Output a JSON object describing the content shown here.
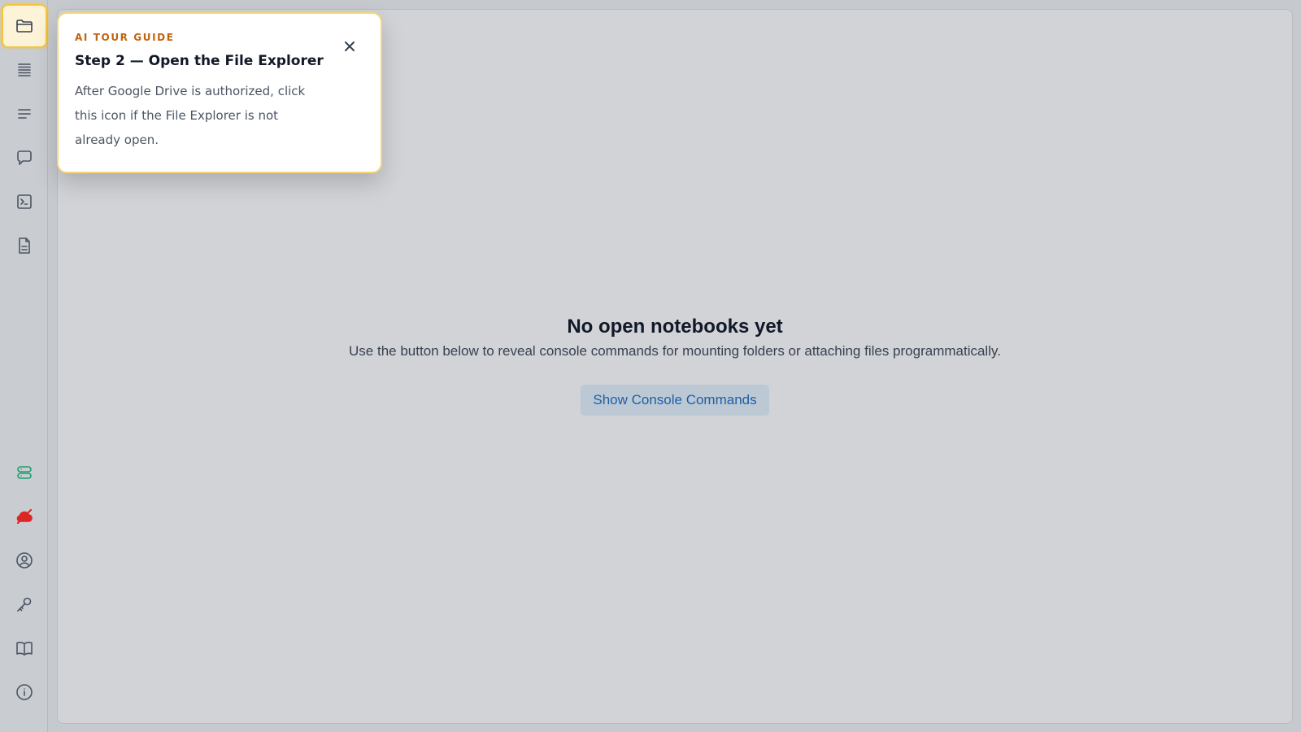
{
  "sidebar": {
    "top_items": [
      {
        "icon": "folder-icon",
        "active": true
      },
      {
        "icon": "table-of-contents-icon",
        "active": false
      },
      {
        "icon": "outline-icon",
        "active": false
      },
      {
        "icon": "comments-icon",
        "active": false
      },
      {
        "icon": "terminal-icon",
        "active": false
      },
      {
        "icon": "document-icon",
        "active": false
      }
    ],
    "bottom_items": [
      {
        "icon": "storage-icon",
        "color": "#1f9d6c"
      },
      {
        "icon": "cloud-off-icon",
        "color": "#dc2626"
      },
      {
        "icon": "account-icon"
      },
      {
        "icon": "key-icon"
      },
      {
        "icon": "book-icon"
      },
      {
        "icon": "info-icon"
      }
    ]
  },
  "main": {
    "empty_title": "No open notebooks yet",
    "empty_description": "Use the button below to reveal console commands for mounting folders or attaching files programmatically.",
    "console_button_label": "Show Console Commands"
  },
  "tour": {
    "kicker": "AI TOUR GUIDE",
    "title": "Step 2 — Open the File Explorer",
    "body": "After Google Drive is authorized, click this icon if the File Explorer is not already open.",
    "close_icon": "close-icon"
  },
  "colors": {
    "highlight_border": "#f4c542",
    "kicker": "#c2620c",
    "button_text": "#1d5fa6",
    "storage_ok": "#1f9d6c",
    "drive_error": "#dc2626"
  }
}
